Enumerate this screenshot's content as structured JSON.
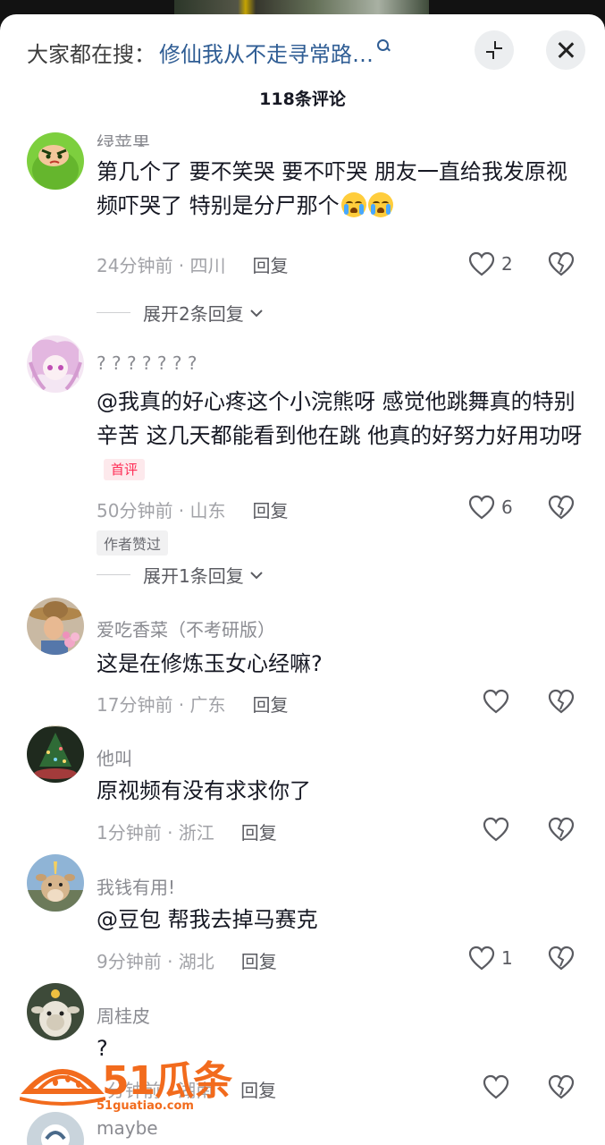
{
  "header": {
    "search_prefix": "大家都在搜：",
    "search_query": "修仙我从不走寻常路…",
    "comment_count": "118条评论"
  },
  "comments": [
    {
      "nickname": "绿苹果",
      "text": "第几个了 要不笑哭 要不吓哭 朋友一直给我发原视频吓哭了 特别是分尸那个",
      "emojis": [
        "loudly-crying-face",
        "loudly-crying-face"
      ],
      "time": "24分钟前 · 四川",
      "reply": "回复",
      "likes": "2",
      "expand": "展开2条回复"
    },
    {
      "nickname": "? ? ? ? ? ? ?",
      "text": "@我真的好心疼这个小浣熊呀 感觉他跳舞真的特别辛苦  这几天都能看到他在跳 他真的好努力好用功呀",
      "tag": "首评",
      "time": "50分钟前 · 山东",
      "reply": "回复",
      "likes": "6",
      "author_badge": "作者赞过",
      "expand": "展开1条回复"
    },
    {
      "nickname": "爱吃香菜（不考研版）",
      "text": "这是在修炼玉女心经嘛?",
      "time": "17分钟前 · 广东",
      "reply": "回复",
      "likes": ""
    },
    {
      "nickname": "他叫",
      "text": "原视频有没有求求你了",
      "time": "1分钟前 · 浙江",
      "reply": "回复",
      "likes": ""
    },
    {
      "nickname": "我钱有用!",
      "text": "@豆包 帮我去掉马赛克",
      "time": "9分钟前 · 湖北",
      "reply": "回复",
      "likes": "1"
    },
    {
      "nickname": "周桂皮",
      "text": "?",
      "time": "分钟前 · 湖南",
      "reply": "回复",
      "likes": ""
    },
    {
      "nickname": "maybe"
    }
  ],
  "watermark": {
    "brand": "51瓜条",
    "url": "51guatiao.com"
  },
  "icons": {
    "search": "search-icon",
    "collapse": "collapse-icon",
    "close": "close-icon",
    "like": "heart-icon",
    "dislike": "broken-heart-icon",
    "expand": "chevron-down-icon"
  },
  "colors": {
    "search_query": "#2f5d94",
    "first_comment_tag": "#fe2c55",
    "watermark": "#f26b1d"
  }
}
